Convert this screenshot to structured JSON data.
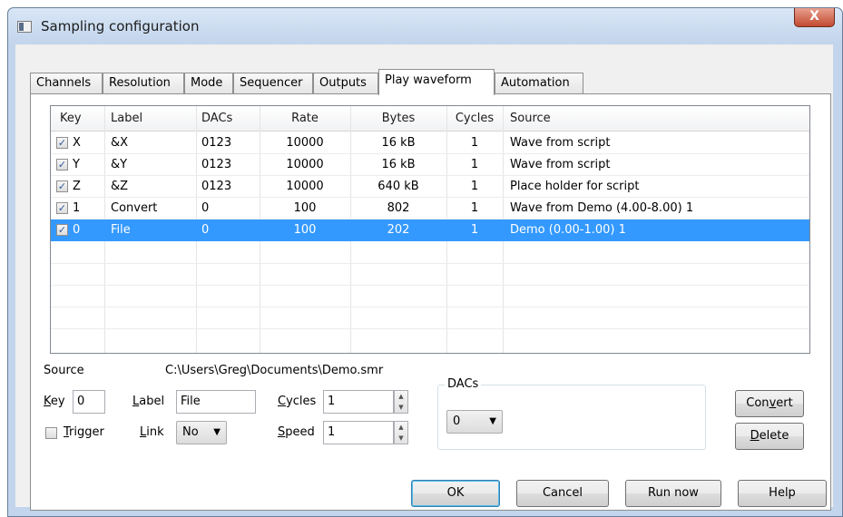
{
  "window": {
    "title": "Sampling configuration",
    "close_glyph": "X"
  },
  "tabs": [
    {
      "label": "Channels"
    },
    {
      "label": "Resolution"
    },
    {
      "label": "Mode"
    },
    {
      "label": "Sequencer"
    },
    {
      "label": "Outputs"
    },
    {
      "label": "Play waveform",
      "active": true
    },
    {
      "label": "Automation"
    }
  ],
  "list": {
    "columns": [
      "Key",
      "Label",
      "DACs",
      "Rate",
      "Bytes",
      "Cycles",
      "Source"
    ],
    "rows": [
      {
        "checked": true,
        "key": "X",
        "label": "&X",
        "dacs": "0123",
        "rate": "10000",
        "bytes": "16 kB",
        "cycles": "1",
        "source": "Wave from script"
      },
      {
        "checked": true,
        "key": "Y",
        "label": "&Y",
        "dacs": "0123",
        "rate": "10000",
        "bytes": "16 kB",
        "cycles": "1",
        "source": "Wave from script"
      },
      {
        "checked": true,
        "key": "Z",
        "label": "&Z",
        "dacs": "0123",
        "rate": "10000",
        "bytes": "640 kB",
        "cycles": "1",
        "source": "Place holder for script"
      },
      {
        "checked": true,
        "key": "1",
        "label": "Convert",
        "dacs": "0",
        "rate": "100",
        "bytes": "802",
        "cycles": "1",
        "source": "Wave from Demo (4.00-8.00) 1"
      },
      {
        "checked": true,
        "key": "0",
        "label": "File",
        "dacs": "0",
        "rate": "100",
        "bytes": "202",
        "cycles": "1",
        "source": "Demo (0.00-1.00) 1",
        "selected": true
      }
    ],
    "check_glyph": "✓"
  },
  "form": {
    "source_label": "Source",
    "source_path": "C:\\Users\\Greg\\Documents\\Demo.smr",
    "key_label": "Key",
    "key_value": "0",
    "label_label": "Label",
    "label_value": "File",
    "cycles_label": "Cycles",
    "cycles_value": "1",
    "speed_label": "Speed",
    "speed_value": "1",
    "trigger_label": "Trigger",
    "link_label": "Link",
    "link_value": "No",
    "dacs_group": "DACs",
    "dacs_value": "0",
    "convert_label": "Convert",
    "delete_label": "Delete"
  },
  "buttons": {
    "ok": "OK",
    "cancel": "Cancel",
    "run_now": "Run now",
    "help": "Help"
  },
  "colors": {
    "selection": "#3399ff",
    "frame": "#c2d5ec",
    "close": "#c24a31"
  }
}
